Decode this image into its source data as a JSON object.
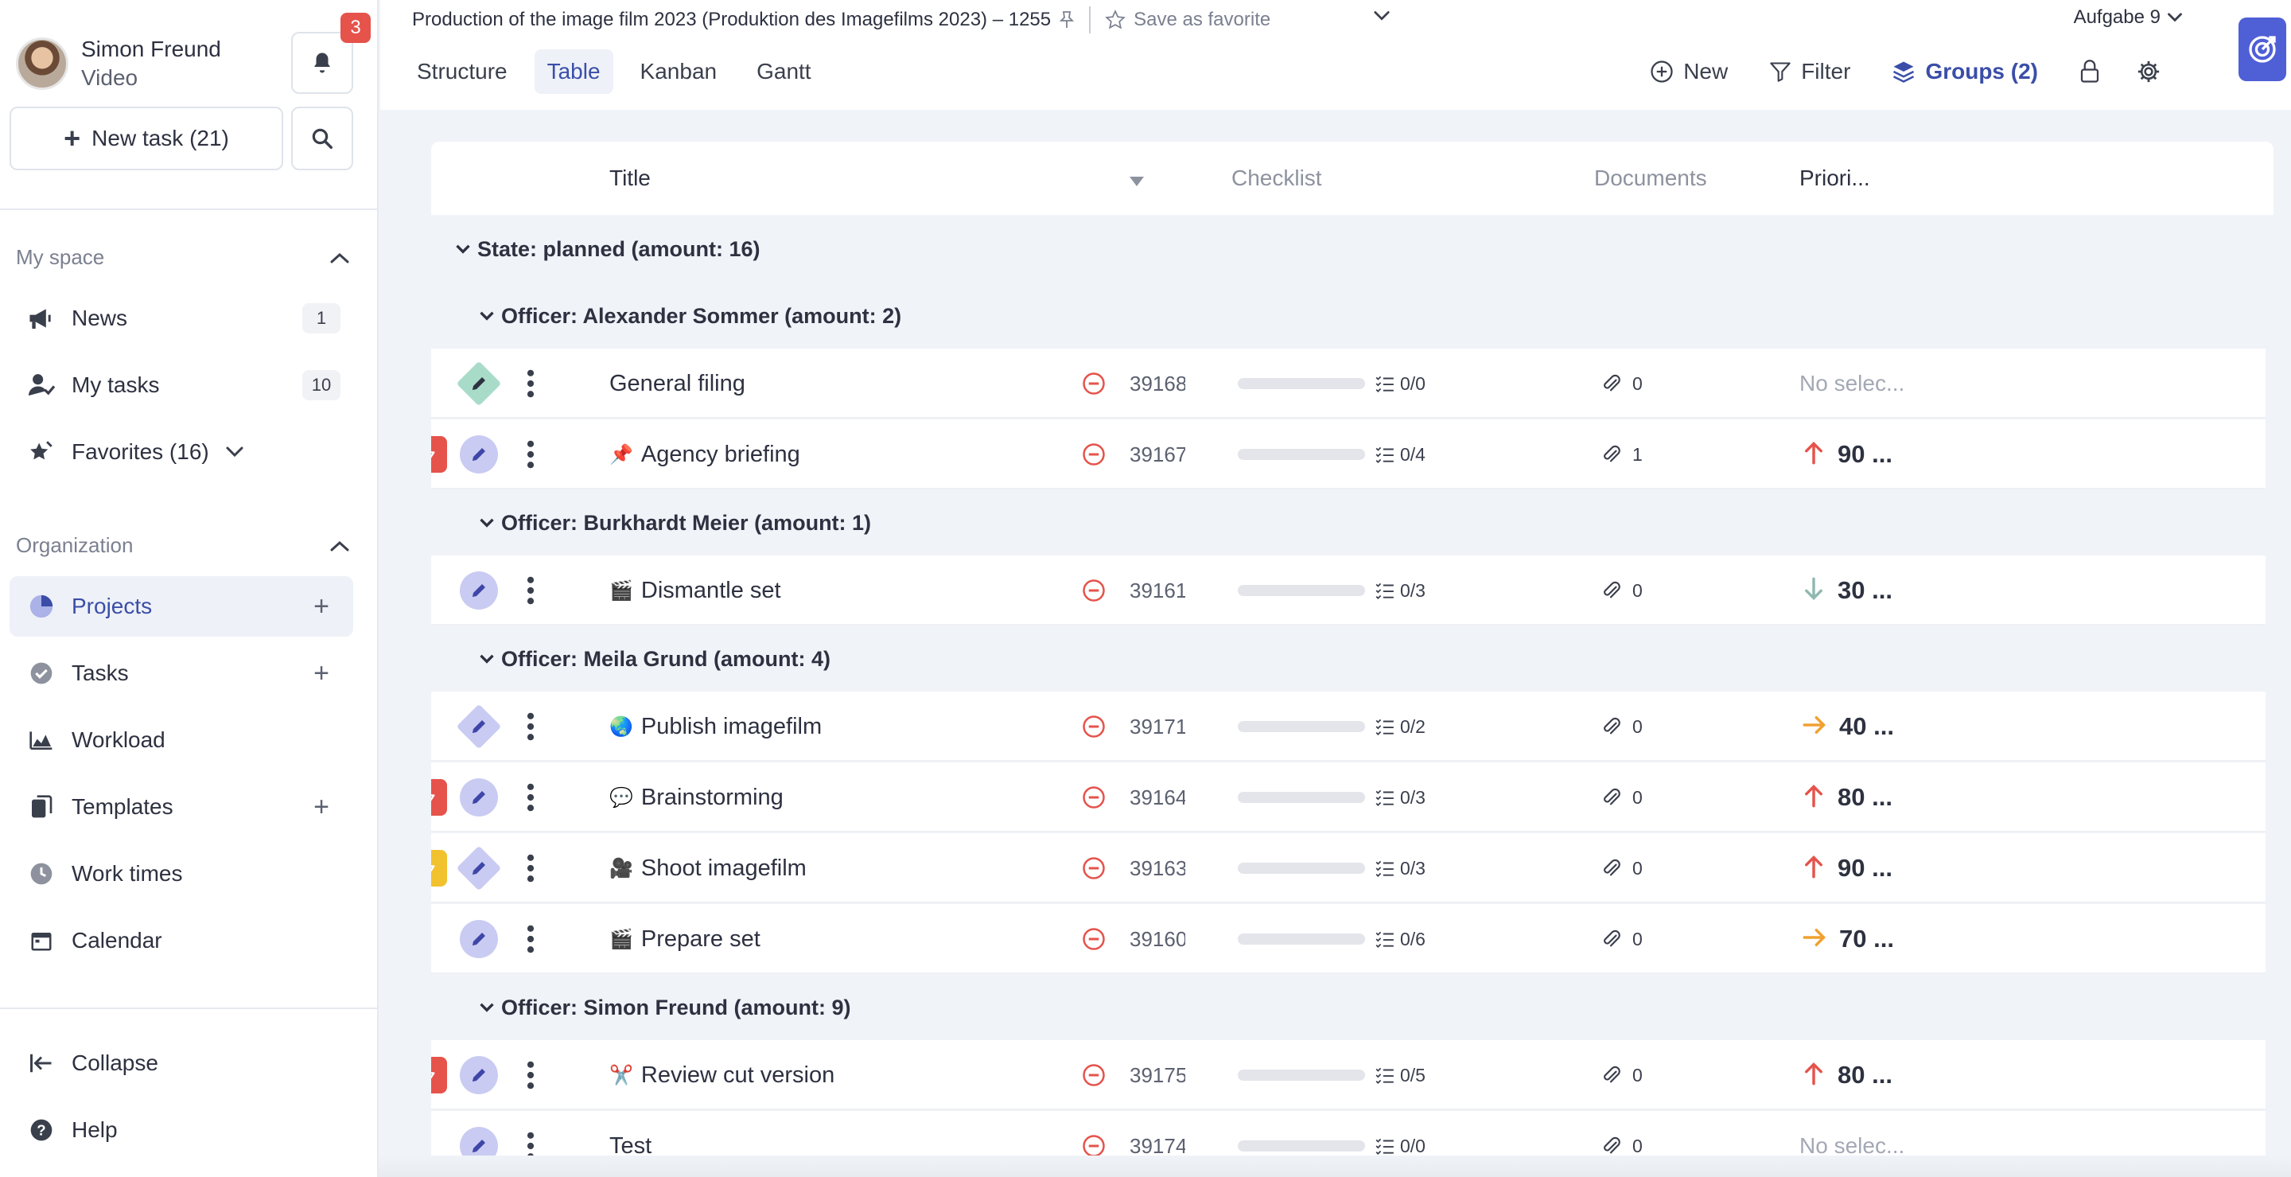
{
  "user": {
    "name": "Simon Freund",
    "role": "Video",
    "notifications": "3"
  },
  "sidebar": {
    "new_task_label": "New task (21)",
    "my_space": {
      "heading": "My space",
      "items": [
        {
          "label": "News",
          "count": "1",
          "icon": "megaphone-icon"
        },
        {
          "label": "My tasks",
          "count": "10",
          "icon": "user-check-icon"
        },
        {
          "label": "Favorites (16)",
          "icon": "star-icon"
        }
      ]
    },
    "organization": {
      "heading": "Organization",
      "items": [
        {
          "label": "Projects",
          "icon": "pie-chart-icon",
          "active": true
        },
        {
          "label": "Tasks",
          "icon": "check-circle-icon"
        },
        {
          "label": "Workload",
          "icon": "area-chart-icon"
        },
        {
          "label": "Templates",
          "icon": "copy-icon"
        },
        {
          "label": "Work times",
          "icon": "clock-icon"
        },
        {
          "label": "Calendar",
          "icon": "calendar-icon"
        }
      ]
    },
    "collapse_label": "Collapse",
    "help_label": "Help"
  },
  "header": {
    "project_title": "Production of the image film 2023 (Produktion des Imagefilms 2023) – 1255",
    "save_favorite_label": "Save as favorite",
    "task_selector": "Aufgabe 9",
    "tabs": [
      "Structure",
      "Table",
      "Kanban",
      "Gantt"
    ],
    "active_tab": "Table",
    "actions": {
      "new": "New",
      "filter": "Filter",
      "groups": "Groups (2)"
    }
  },
  "table": {
    "columns": {
      "title": "Title",
      "checklist": "Checklist",
      "documents": "Documents",
      "priority": "Priori..."
    },
    "state_group": "State: planned (amount: 16)",
    "officer_groups": [
      "Officer: Alexander Sommer (amount: 2)",
      "Officer: Burkhardt Meier (amount: 1)",
      "Officer: Meila Grund (amount: 4)",
      "Officer: Simon Freund (amount: 9)"
    ],
    "rows": [
      {
        "title": "General filing",
        "emoji": "",
        "id": "39168",
        "checklist": "0/0",
        "docs": "0",
        "priority": "No selec...",
        "prio_dir": "none",
        "flag": "none",
        "edit": "diamond-green"
      },
      {
        "title": "Agency briefing",
        "emoji": "📌",
        "id": "39167",
        "checklist": "0/4",
        "docs": "1",
        "priority": "90 ...",
        "prio_dir": "up",
        "flag": "red",
        "edit": "circle"
      },
      {
        "title": "Dismantle set",
        "emoji": "🎬",
        "id": "39161",
        "checklist": "0/3",
        "docs": "0",
        "priority": "30 ...",
        "prio_dir": "down",
        "flag": "none",
        "edit": "circle"
      },
      {
        "title": "Publish imagefilm",
        "emoji": "🌏",
        "id": "39171",
        "checklist": "0/2",
        "docs": "0",
        "priority": "40 ...",
        "prio_dir": "right",
        "flag": "none",
        "edit": "diamond-purple"
      },
      {
        "title": "Brainstorming",
        "emoji": "💬",
        "id": "39164",
        "checklist": "0/3",
        "docs": "0",
        "priority": "80 ...",
        "prio_dir": "up",
        "flag": "red",
        "edit": "circle"
      },
      {
        "title": "Shoot imagefilm",
        "emoji": "🎥",
        "id": "39163",
        "checklist": "0/3",
        "docs": "0",
        "priority": "90 ...",
        "prio_dir": "up",
        "flag": "yellow",
        "edit": "diamond-purple"
      },
      {
        "title": "Prepare set",
        "emoji": "🎬",
        "id": "39160",
        "checklist": "0/6",
        "docs": "0",
        "priority": "70 ...",
        "prio_dir": "right",
        "flag": "none",
        "edit": "circle"
      },
      {
        "title": "Review cut version",
        "emoji": "✂️",
        "id": "39175",
        "checklist": "0/5",
        "docs": "0",
        "priority": "80 ...",
        "prio_dir": "up",
        "flag": "red",
        "edit": "circle"
      },
      {
        "title": "Test",
        "emoji": "",
        "id": "39174",
        "checklist": "0/0",
        "docs": "0",
        "priority": "No selec...",
        "prio_dir": "none",
        "flag": "none",
        "edit": "circle"
      }
    ]
  },
  "colors": {
    "accent": "#3a4ea8",
    "flag_red": "#e5534b",
    "flag_yellow": "#f2c12e",
    "arrow_up": "#e5534b",
    "arrow_right": "#f0a030",
    "arrow_down": "#8fb8b0",
    "edit_purple": "#c9cbf2",
    "edit_green": "#a8dcc9"
  }
}
